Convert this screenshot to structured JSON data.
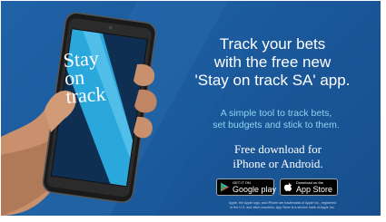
{
  "headline": {
    "line1": "Track your bets",
    "line2": "with the free new",
    "line3": "'Stay on track SA' app."
  },
  "subheadline": {
    "line1": "A simple tool to track bets,",
    "line2": "set budgets and stick to them."
  },
  "download": {
    "line1": "Free download for",
    "line2": "iPhone or Android."
  },
  "phone_screen": {
    "line1": "Stay",
    "line2": "on",
    "line3": "track"
  },
  "badges": {
    "google_play_small": "GET IT ON",
    "google_play_big": "Google play",
    "app_store_small": "Download on the",
    "app_store_big": "App Store"
  },
  "legal": {
    "line1": "Apple, the Apple logo, and iPhone are trademarks of Apple Inc., registered",
    "line2": "in the U.S. and other countries. App Store is a service mark of Apple Inc."
  },
  "colors": {
    "background": "#1b5a9c",
    "accent_cyan": "#8fd3ee",
    "screen_stripe": "#3fb7e6"
  }
}
